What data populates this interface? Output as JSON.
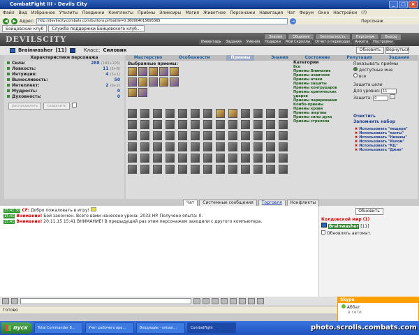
{
  "window": {
    "title": "CombatFight III - Devils City"
  },
  "menu": [
    "Файл",
    "Вид",
    "Избранное",
    "Утилиты",
    "Поединки",
    "Комплекты",
    "Приёмы",
    "Эликсиры",
    "Магия",
    "Животное",
    "Персонажи",
    "Навигация",
    "Чат",
    "Форум",
    "Окно",
    "Настройки",
    "(?)"
  ],
  "address": {
    "label": "Адрес:",
    "url": "http://devilscity.combats.com/buttons.pl?battle=0.360904015695365",
    "search_label": "Персонаж"
  },
  "tabs": [
    {
      "label": "Бойцовский клуб"
    },
    {
      "label": "Служба поддержки Бойцовского клуб..."
    }
  ],
  "game": {
    "logo": "DEVILSCITY",
    "topnav": [
      "Знания",
      "Общение",
      "Безопасность",
      "Персонаж",
      "Выход"
    ],
    "subnav": [
      "Инвентарь",
      "Задания",
      "Умения",
      "Подарки",
      "Мой Скроллы",
      "Отчет о переводах",
      "Анкета",
      "Настройки"
    ]
  },
  "player": {
    "name": "Brainwasher",
    "level": "[11]",
    "class_label": "Класс:",
    "class_value": "Силовик"
  },
  "buttons": {
    "refresh": "Обновить",
    "back": "Вернуться"
  },
  "stats": {
    "header": "Характеристики персонажа",
    "rows": [
      {
        "label": "Сила:",
        "value": "288",
        "extra": "(183+105)"
      },
      {
        "label": "Ловкость:",
        "value": "11",
        "extra": "(3+8)"
      },
      {
        "label": "Интуиция:",
        "value": "4",
        "extra": "(3+1)"
      },
      {
        "label": "Выносливость:",
        "value": "50",
        "extra": ""
      },
      {
        "label": "Интеллект:",
        "value": "2",
        "extra": "(0+2)"
      },
      {
        "label": "Мудрость:",
        "value": "0",
        "extra": ""
      },
      {
        "label": "Духовность:",
        "value": "0",
        "extra": ""
      }
    ],
    "distribute": "распределить",
    "save": "сохранить"
  },
  "navtabs": [
    "Мастерство",
    "Особенности",
    "Приемы",
    "Знания",
    "Состояние",
    "Репутация",
    "Задания"
  ],
  "selected_label": "Выбранные приемы:",
  "categories": {
    "header": "Категории",
    "items": [
      "Все",
      "Приемы Внимания",
      "Приемы новичков",
      "Приемы атаки",
      "Приемы защиты",
      "Приемы контрударов",
      "Приемы критических ударов",
      "Приемы парирования",
      "Комбо-приемы",
      "Приемы крови",
      "Приемы жертвы",
      "Приемы силы духа",
      "Приемы стрелков"
    ]
  },
  "filter": {
    "header": "Показывать приёмы",
    "opt1": "доступные мне",
    "opt2": "все",
    "shield_header": "Защита цели",
    "level_label": "Для уровня:",
    "level_value": "11",
    "defense_label": "Защита:",
    "defense_value": "0"
  },
  "actions": {
    "clear": "Очистить",
    "remember": "Запомнить набор"
  },
  "sets": [
    "Использовать \"пещера\"",
    "Использовать \"касты\"",
    "Использовать \"Низины\"",
    "Использовать \"Излом\"",
    "Использовать \"КЦ\"",
    "Использовать \"Джин\""
  ],
  "chattabs": [
    "Чат",
    "Системные сообщения",
    "Торговля",
    "Конфликты"
  ],
  "chat": [
    {
      "time": "15:41:30",
      "who": "CF:",
      "text": "Добро пожаловать в игру!"
    },
    {
      "time": "15:41",
      "who": "Внимание!",
      "text": "Бой закончен. Всего вами нанесено урона: 2033 HP. Получено опыта: 0."
    },
    {
      "time": "15:41",
      "who": "Внимание!",
      "text": "20.11.15 15:41 ВНИМАНИЕ! В предыдущий раз этим персонажем заходили с другого компьютера."
    }
  ],
  "userpanel": {
    "refresh": "Обновить",
    "world": "Колдовской мир (1)",
    "user": "Brainwasher",
    "user_level": "[11]",
    "auto": "Обновлять автомат."
  },
  "status": {
    "text": "Готово"
  },
  "taskbar": {
    "start": "пуск",
    "items": [
      "Total Commander 8...",
      "Учет рабочего вре...",
      "Входящие - smsun...",
      "CombatFight"
    ]
  },
  "skype": {
    "title": "Skype",
    "contact": "Аббат",
    "status": "в сети"
  },
  "watermark": "photo.scrolls.combats.com",
  "colors": {
    "accent": "#1f5f9f",
    "green": "#1a5a1a",
    "warn": "#cc0000"
  }
}
